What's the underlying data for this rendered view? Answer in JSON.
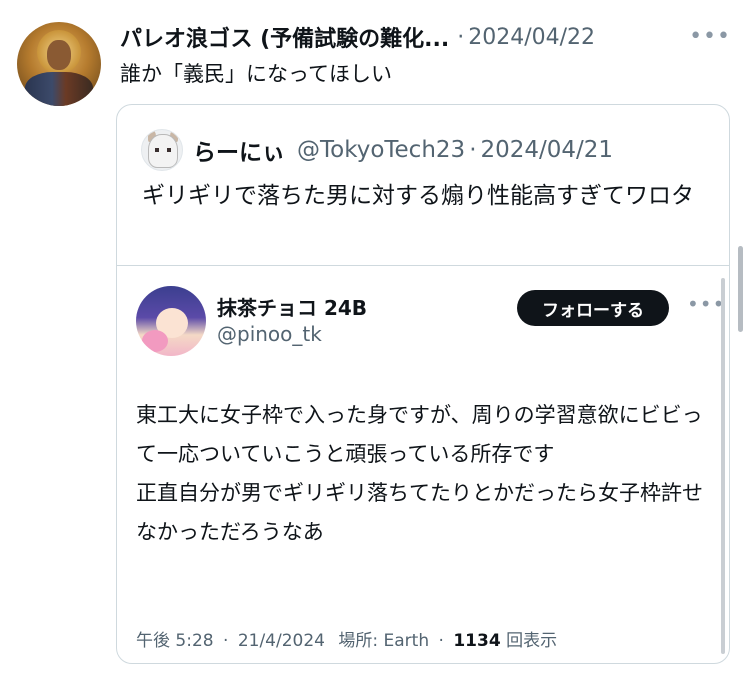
{
  "outer": {
    "name": "パレオ浪ゴス (予備試験の難化...",
    "separator": "·",
    "date": "2024/04/22",
    "more": "•••",
    "text": "誰か「義民」になってほしい"
  },
  "quote": {
    "name": "らーにぃ",
    "handle": "@TokyoTech23",
    "separator": "·",
    "date": "2024/04/21",
    "text": "ギリギリで落ちた男に対する煽り性能高すぎてワロタ"
  },
  "inner": {
    "name": "抹茶チョコ 24B",
    "handle": "@pinoo_tk",
    "follow_label": "フォローする",
    "more": "•••",
    "text_lines": [
      "東工大に女子枠で入った身ですが、周りの学習意欲にビビって一応ついていこうと頑張っている所存です",
      "正直自分が男でギリギリ落ちてたりとかだったら女子枠許せなかっただろうなあ"
    ],
    "footer": {
      "time": "午後 5:28",
      "sep1": "·",
      "date": "21/4/2024",
      "location_label": "場所: Earth",
      "sep2": "·",
      "views_count": "1134",
      "views_label": "回表示"
    }
  }
}
